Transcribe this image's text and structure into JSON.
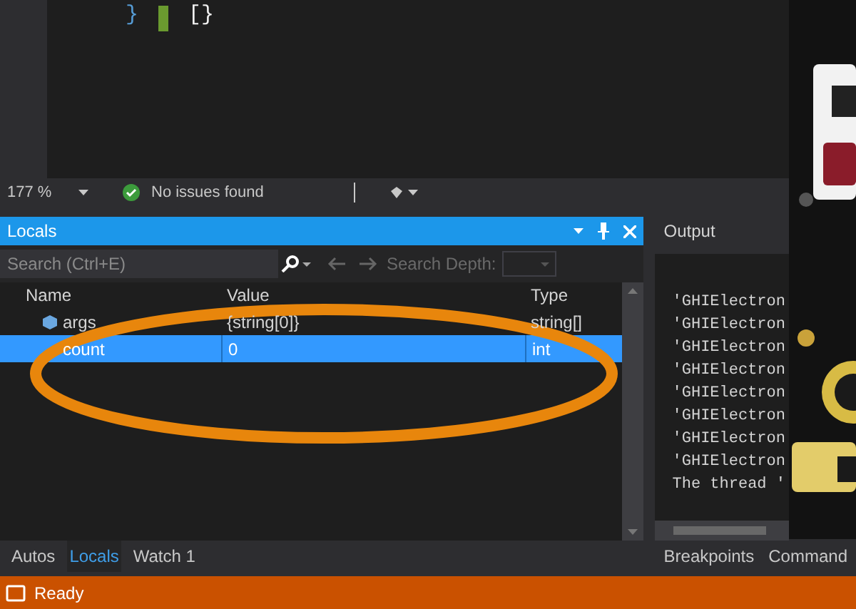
{
  "editor": {
    "code_fragments": [
      {
        "kind": "keyword",
        "text": "}"
      },
      {
        "kind": "punct",
        "text": "[}"
      }
    ],
    "status": {
      "zoom": "177 %",
      "issues": "No issues found"
    }
  },
  "locals": {
    "title": "Locals",
    "search": {
      "placeholder": "Search (Ctrl+E)",
      "depth_label": "Search Depth:"
    },
    "columns": [
      "Name",
      "Value",
      "Type"
    ],
    "rows": [
      {
        "name": "args",
        "value": "{string[0]}",
        "type": "string[]",
        "selected": false
      },
      {
        "name": "count",
        "value": "0",
        "type": "int",
        "selected": true
      }
    ]
  },
  "debug_tabs": [
    {
      "label": "Autos",
      "selected": false
    },
    {
      "label": "Locals",
      "selected": true
    },
    {
      "label": "Watch 1",
      "selected": false
    }
  ],
  "output": {
    "title": "Output",
    "lines": [
      "'GHIElectron",
      "'GHIElectron",
      "'GHIElectron",
      "'GHIElectron",
      "'GHIElectron",
      "'GHIElectron",
      "'GHIElectron",
      "'GHIElectron",
      "The thread '"
    ]
  },
  "output_tabs": [
    "Breakpoints",
    "Command"
  ],
  "status_bar": {
    "text": "Ready"
  }
}
